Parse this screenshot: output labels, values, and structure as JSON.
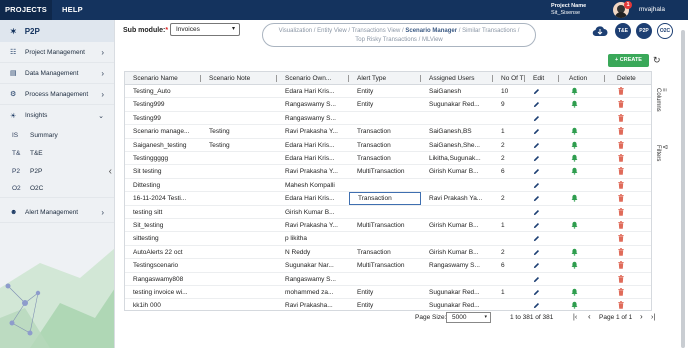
{
  "nav": {
    "tabs": [
      "PROJECTS",
      "HELP"
    ],
    "project_name_label": "Project Name",
    "project_name": "Sit_Sisense",
    "notification_count": "1",
    "username": "mvajhala"
  },
  "sidebar": {
    "module_title": "P2P",
    "items": [
      {
        "label": "Project Management",
        "icon": "sitemap-icon"
      },
      {
        "label": "Data Management",
        "icon": "database-icon"
      },
      {
        "label": "Process Management",
        "icon": "cogs-icon"
      },
      {
        "label": "Insights",
        "icon": "lightbulb-icon"
      },
      {
        "label": "Alert Management",
        "icon": "users-icon"
      }
    ],
    "insights_sub": [
      {
        "abbr": "IS",
        "label": "Summary"
      },
      {
        "abbr": "T&",
        "label": "T&E"
      },
      {
        "abbr": "P2",
        "label": "P2P"
      },
      {
        "abbr": "O2",
        "label": "O2C"
      }
    ]
  },
  "header": {
    "submodule_label": "Sub module:",
    "submodule_required": "*",
    "submodule_value": "Invoices",
    "breadcrumbs_line1": [
      "Visualization",
      "Entity View",
      "Transactions View",
      "Scenario Manager",
      "Similar Transactions"
    ],
    "breadcrumbs_line2": [
      "Top Risky Transactions",
      "MLView"
    ],
    "active_breadcrumb": "Scenario Manager",
    "buttons": [
      "T&E",
      "P2P",
      "O2C"
    ],
    "create_label": "CREATE"
  },
  "grid": {
    "columns": [
      "Scenario Name",
      "Scenario Note",
      "Scenario Own...",
      "Alert Type",
      "Assigned Users",
      "No Of T",
      "Edit",
      "Action",
      "Delete"
    ],
    "rows": [
      [
        "Testing_Auto",
        "",
        "Edara Hari Kris...",
        "Entity",
        "SaiGanesh",
        "10",
        true,
        true
      ],
      [
        "Testing999",
        "",
        "Rangaswamy S...",
        "Entity",
        "Sugunakar Red...",
        "9",
        true,
        true
      ],
      [
        "Testing99",
        "",
        "Rangaswamy S...",
        "",
        "",
        "",
        true,
        false
      ],
      [
        "Scenario manage...",
        "Testing",
        "Ravi Prakasha Y...",
        "Transaction",
        "SaiGanesh,BS",
        "1",
        true,
        true
      ],
      [
        "Saiganesh_testing",
        "Testing",
        "Edara Hari Kris...",
        "Transaction",
        "SaiGanesh,She...",
        "2",
        true,
        true
      ],
      [
        "Testinggggg",
        "",
        "Edara Hari Kris...",
        "Transaction",
        "Likitha,Sugunak...",
        "2",
        true,
        true
      ],
      [
        "Sit testing",
        "",
        "Ravi Prakasha Y...",
        "MultiTransaction",
        "Girish Kumar B...",
        "6",
        true,
        true
      ],
      [
        "Dittesting",
        "",
        "Mahesh Kompalli",
        "",
        "",
        "",
        true,
        false
      ],
      [
        "16-11-2024 Testi...",
        "",
        "Edara Hari Kris...",
        "Transaction",
        "Ravi Prakash Ya...",
        "2",
        true,
        true
      ],
      [
        "testing sitt",
        "",
        "Girish Kumar B...",
        "",
        "",
        "",
        true,
        false
      ],
      [
        "Sit_testing",
        "",
        "Ravi Prakasha Y...",
        "MultiTransaction",
        "Girish Kumar B...",
        "1",
        true,
        true
      ],
      [
        "sittesting",
        "",
        "p likitha",
        "",
        "",
        "",
        true,
        false
      ],
      [
        "AutoAlerts 22 oct",
        "",
        "N Reddy",
        "Transaction",
        "Girish Kumar B...",
        "2",
        true,
        true
      ],
      [
        "Testingscenario",
        "",
        "Sugunakar Nar...",
        "MultiTransaction",
        "Rangaswamy S...",
        "6",
        true,
        true
      ],
      [
        "Rangaswamy808",
        "",
        "Rangaswamy S...",
        "",
        "",
        "",
        true,
        false
      ],
      [
        "testing invoice wi...",
        "",
        "mohammed za...",
        "Entity",
        "Sugunakar Red...",
        "1",
        true,
        true
      ],
      [
        "kk1ih 000",
        "",
        "Ravi Prakasha...",
        "Entity",
        "Sugunakar Red...",
        "",
        true,
        true
      ]
    ]
  },
  "side_panel": {
    "columns_label": "Columns",
    "filters_label": "Filters"
  },
  "pager": {
    "page_size_label": "Page Size:",
    "page_size": "5000",
    "range": "1 to 381 of 381",
    "page_label": "Page 1 of 1"
  },
  "colors": {
    "nav": "#14335e",
    "accent": "#1d3f73",
    "create": "#3aa859",
    "bell": "#2f9e4f",
    "trash": "#e06b5a"
  }
}
